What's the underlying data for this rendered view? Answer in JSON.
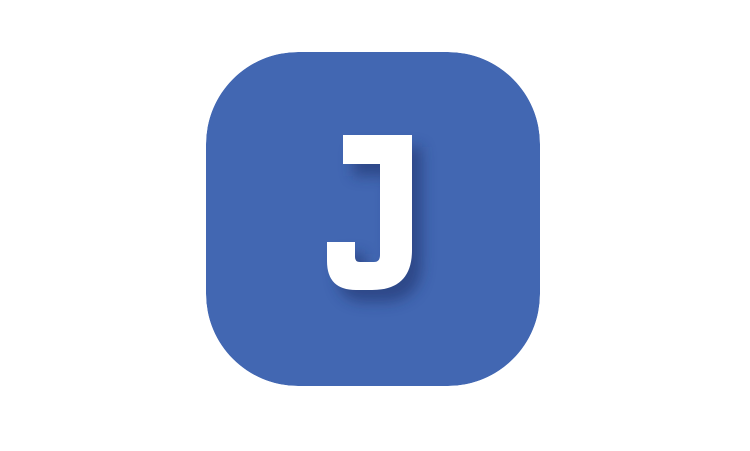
{
  "icon": {
    "name": "j-letter-app-icon",
    "glyph": "J",
    "background_color": "#4267B2",
    "glyph_color": "#FFFFFF",
    "shadow_color": "#1E2F66"
  }
}
